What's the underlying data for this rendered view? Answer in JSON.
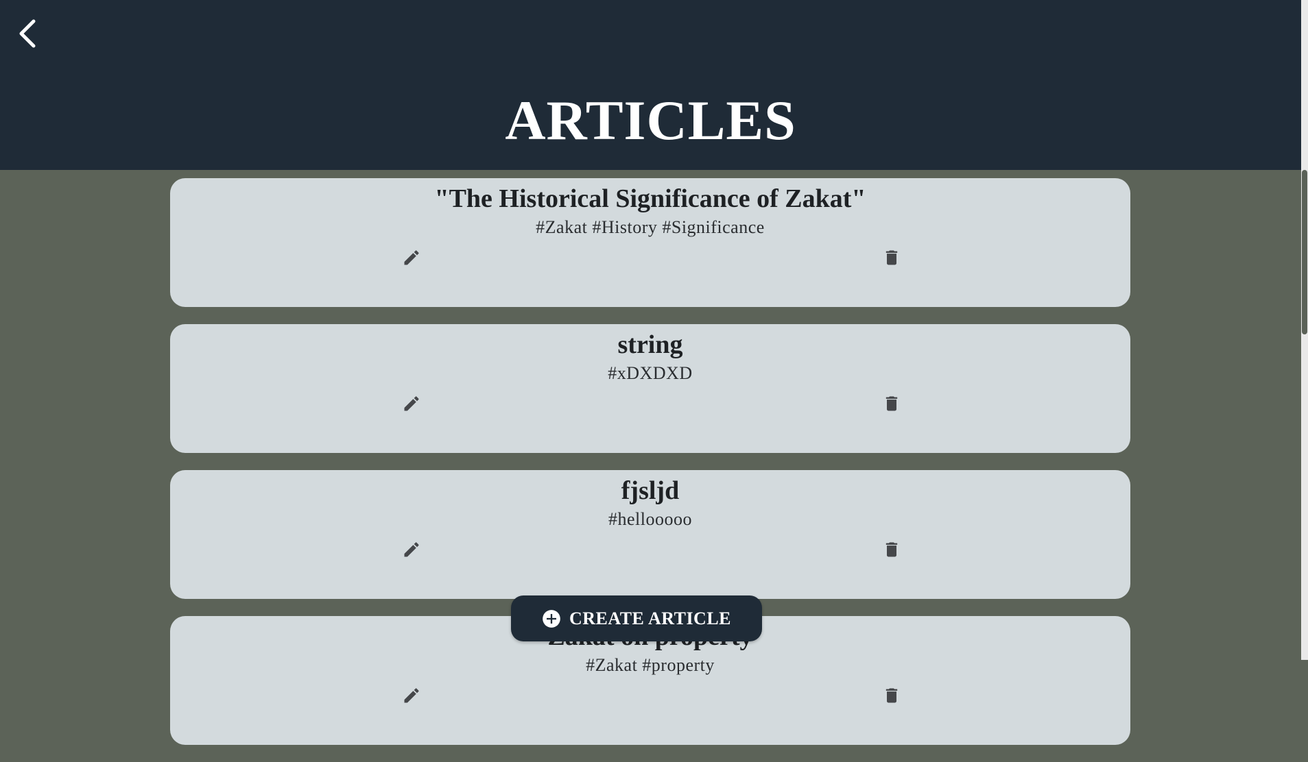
{
  "header": {
    "back_icon": "chevron-left-icon",
    "title": "ARTICLES"
  },
  "articles": [
    {
      "title": "\"The Historical Significance of Zakat\"",
      "tags": "#Zakat #History #Significance"
    },
    {
      "title": "string",
      "tags": "#xDXDXD"
    },
    {
      "title": "fjsljd",
      "tags": "#hellooooo"
    },
    {
      "title": "Zakat on property",
      "tags": "#Zakat #property"
    }
  ],
  "create_button": {
    "icon": "plus-circle-icon",
    "label": "CREATE ARTICLE"
  },
  "icons": {
    "edit": "pencil-icon",
    "delete": "trash-icon"
  },
  "colors": {
    "header_bg": "#1f2b37",
    "page_bg": "#5c6358",
    "card_bg": "#d3dadd",
    "icon": "#45474a"
  }
}
